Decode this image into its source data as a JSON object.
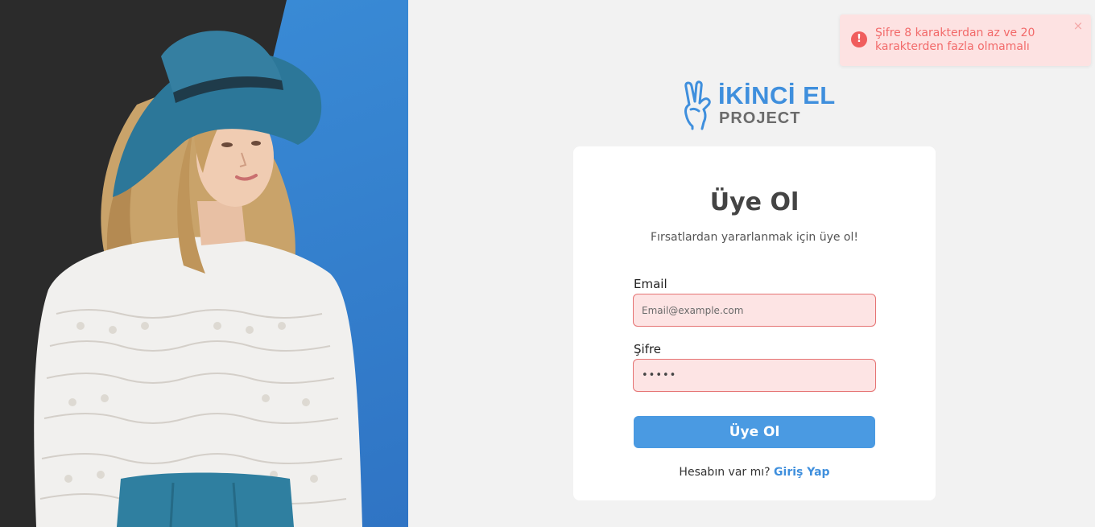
{
  "brand": {
    "line1": "İKİNCİ EL",
    "line2": "PROJECT",
    "color": "#3f8fdd"
  },
  "signup": {
    "title": "Üye Ol",
    "subtitle": "Fırsatlardan yararlanmak için üye ol!",
    "email_label": "Email",
    "email_value": "",
    "email_placeholder": "Email@example.com",
    "password_label": "Şifre",
    "password_value": "•••••",
    "submit_label": "Üye Ol",
    "login_prompt": "Hesabın var mı?",
    "login_link": "Giriş Yap"
  },
  "toast": {
    "message": "Şifre 8 karakterdan az ve 20 karakterden fazla olmamalı",
    "close_symbol": "×",
    "icon": "exclamation-icon",
    "color": "#f26a6a"
  },
  "colors": {
    "accent": "#4a9ae2",
    "error_bg": "#fde4e4",
    "error_border": "#e57373"
  }
}
